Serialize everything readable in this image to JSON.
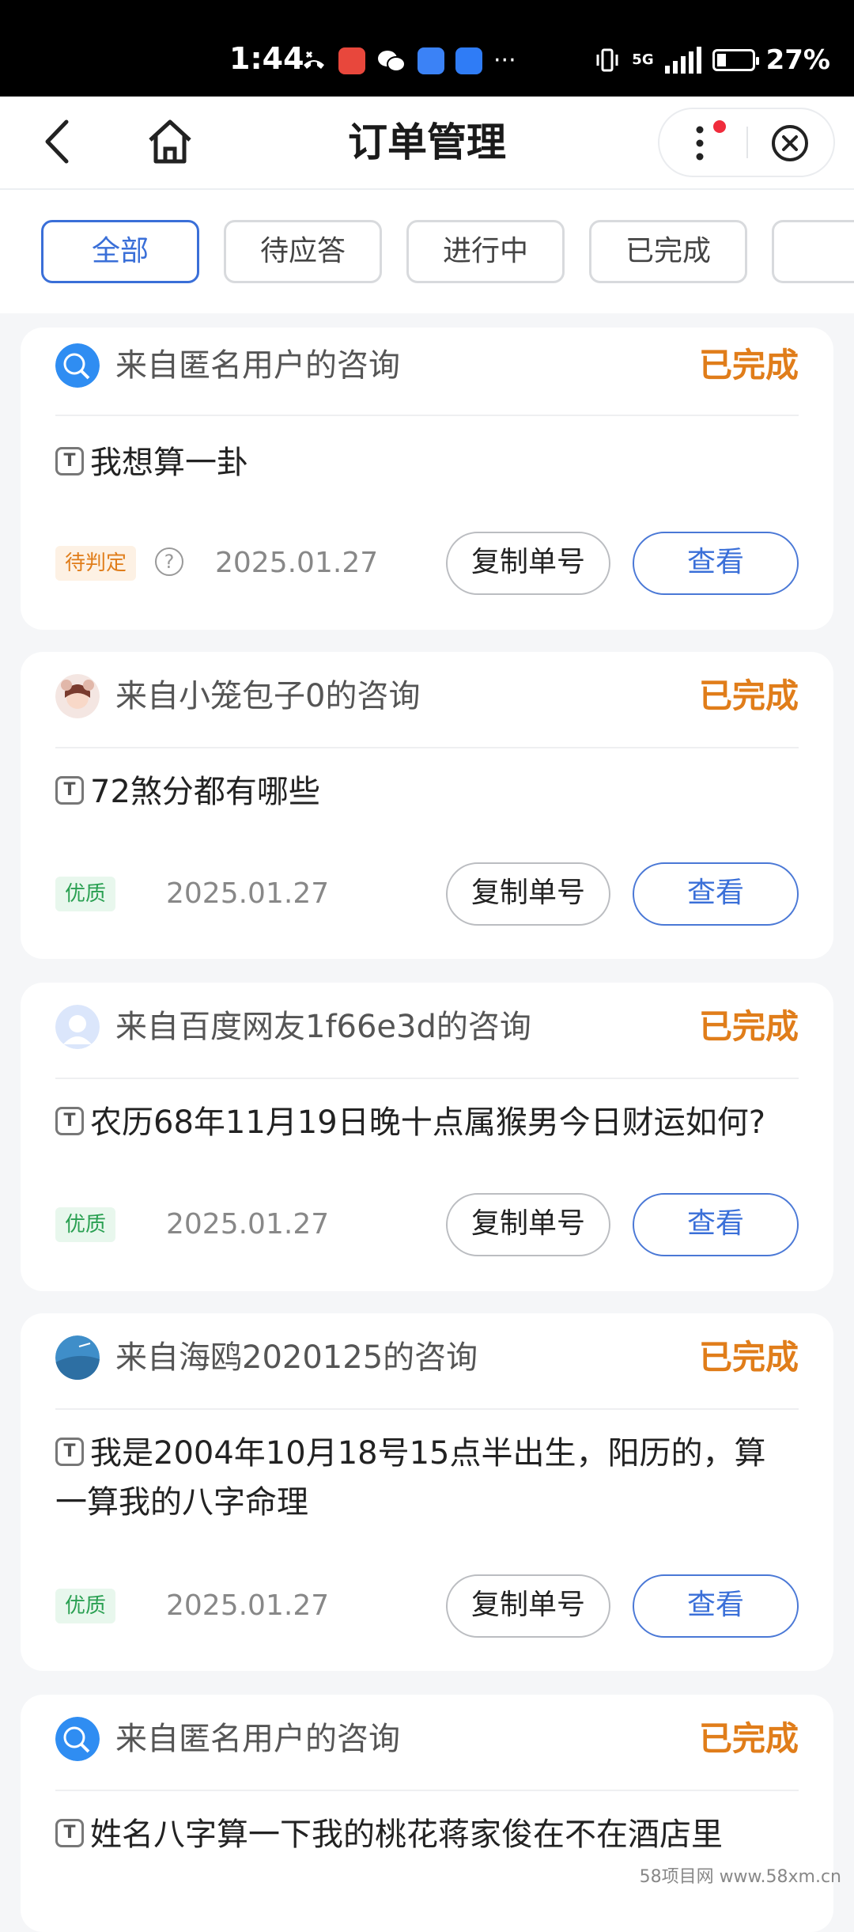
{
  "status_bar": {
    "time": "1:44",
    "network": "5G",
    "battery": "27%",
    "battery_level": 0.27,
    "notification_icons": [
      "missed-call-icon",
      "huawei-app-icon",
      "wechat-icon",
      "baidu-icon",
      "cloud-icon"
    ],
    "more": "···"
  },
  "header": {
    "title": "订单管理"
  },
  "tabs": [
    {
      "label": "全部",
      "active": true
    },
    {
      "label": "待应答",
      "active": false
    },
    {
      "label": "进行中",
      "active": false
    },
    {
      "label": "已完成",
      "active": false
    }
  ],
  "orders": [
    {
      "from": "来自匿名用户的咨询",
      "status": "已完成",
      "question": "我想算一卦",
      "badge": "待判定",
      "date": "2025.01.27",
      "copy_label": "复制单号",
      "view_label": "查看"
    },
    {
      "from": "来自小笼包子0的咨询",
      "status": "已完成",
      "question": "72煞分都有哪些",
      "badge": "优质",
      "date": "2025.01.27",
      "copy_label": "复制单号",
      "view_label": "查看"
    },
    {
      "from": "来自百度网友1f66e3d的咨询",
      "status": "已完成",
      "question": "农历68年11月19日晚十点属猴男今日财运如何?",
      "badge": "优质",
      "date": "2025.01.27",
      "copy_label": "复制单号",
      "view_label": "查看"
    },
    {
      "from": "来自海鸥2020125的咨询",
      "status": "已完成",
      "question": "我是2004年10月18号15点半出生，阳历的，算一算我的八字命理",
      "badge": "优质",
      "date": "2025.01.27",
      "copy_label": "复制单号",
      "view_label": "查看"
    },
    {
      "from": "来自匿名用户的咨询",
      "status": "已完成",
      "question": "姓名八字算一下我的桃花蒋家俊在不在酒店里"
    }
  ],
  "watermark": "58项目网 www.58xm.cn"
}
